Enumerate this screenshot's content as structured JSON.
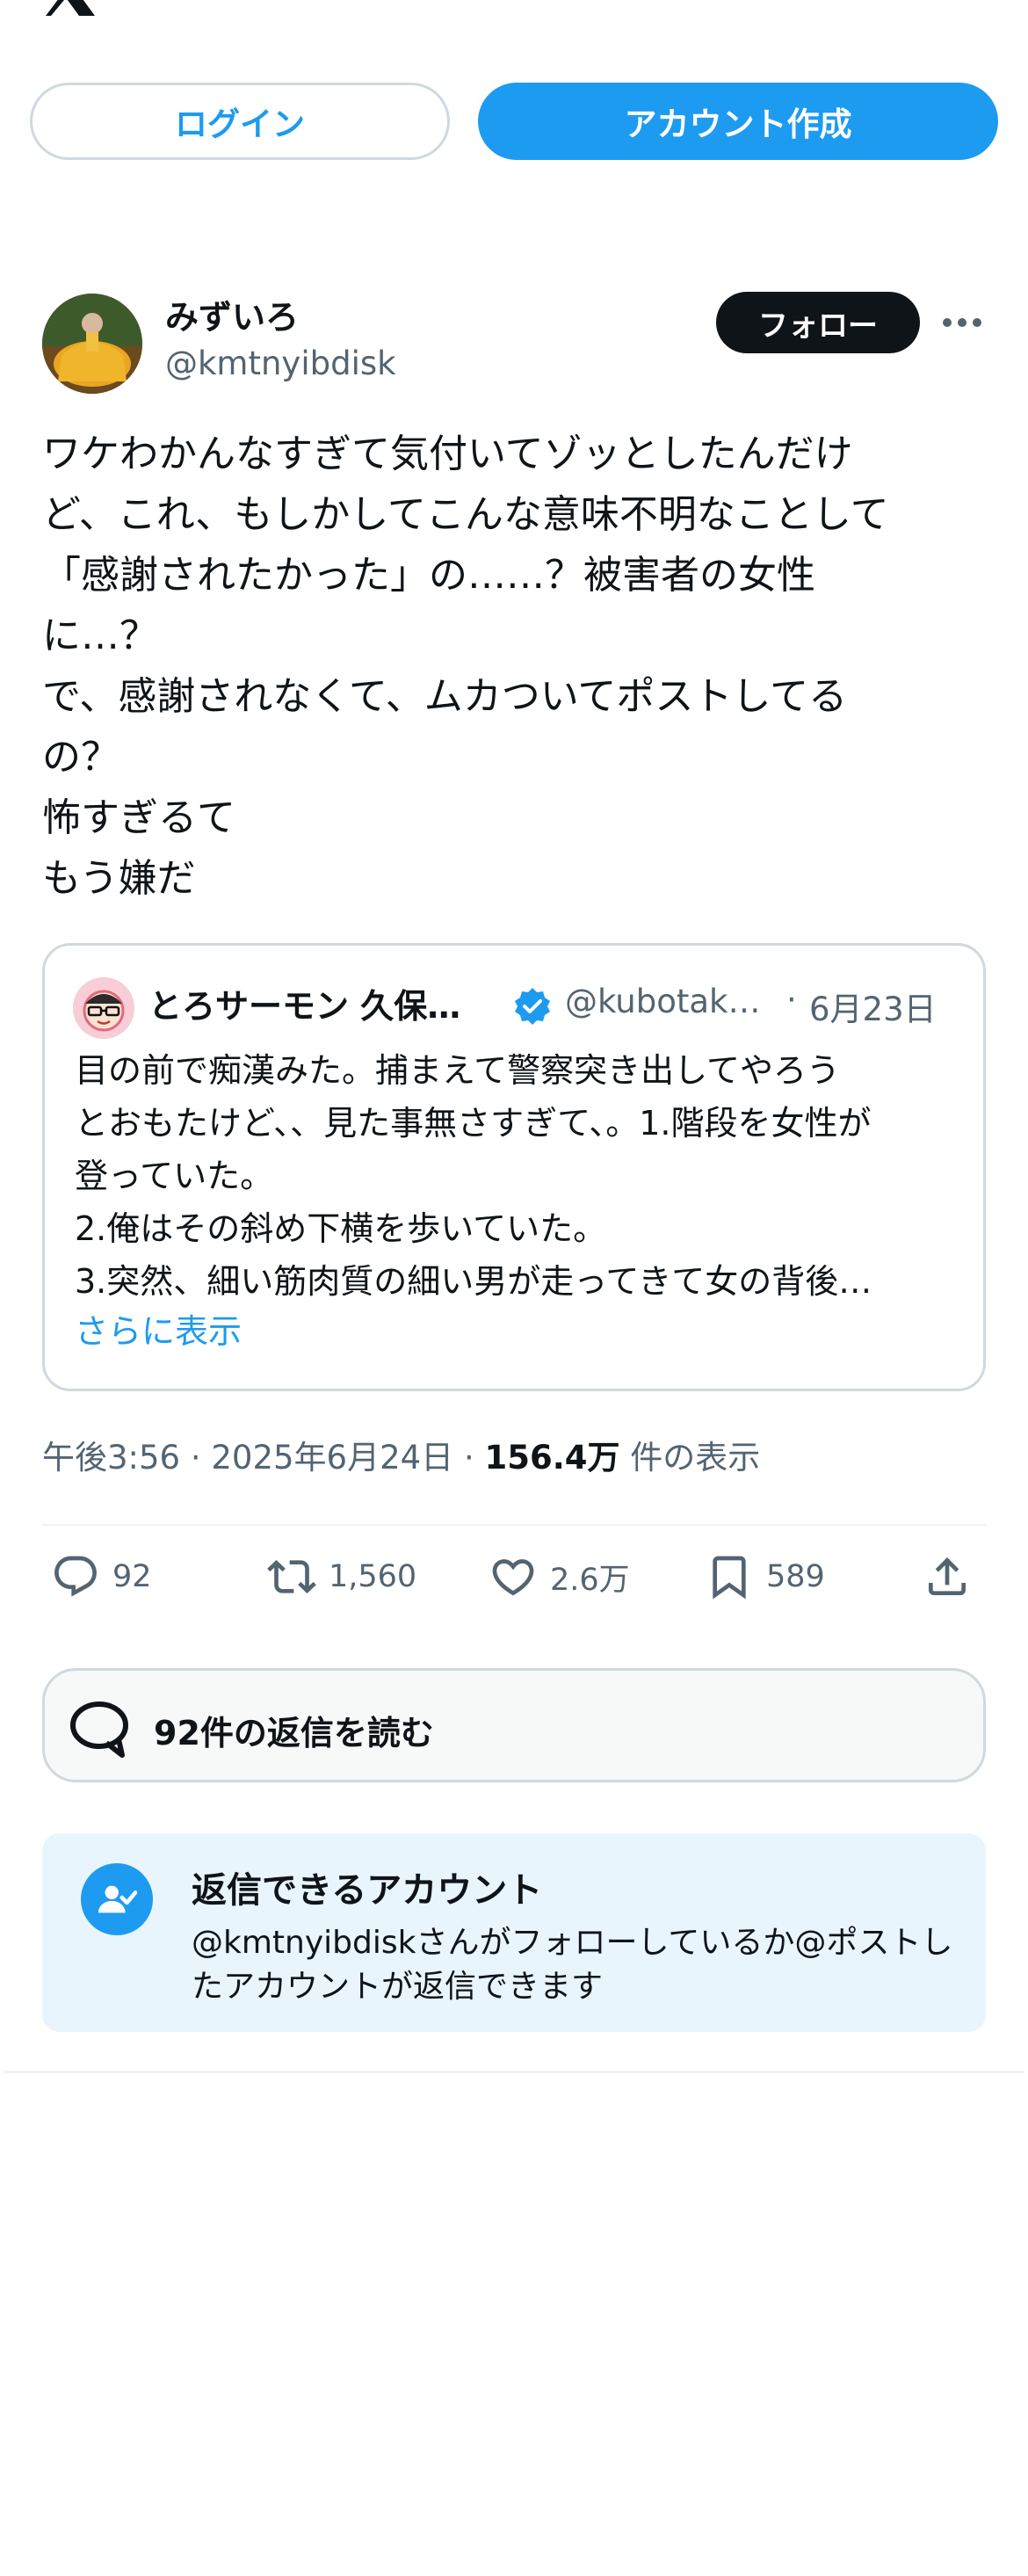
{
  "header": {
    "logo_icon": "x-logo-icon"
  },
  "auth": {
    "login_label": "ログイン",
    "signup_label": "アカウント作成"
  },
  "author": {
    "name": "みずいろ",
    "handle": "@kmtnyibdisk",
    "follow_label": "フォロー",
    "more_icon": "more-horizontal-icon"
  },
  "tweet": {
    "text": "ワケわかんなすぎて気付いてゾッとしたんだけ\nど、これ、もしかしてこんな意味不明なことして\n「感謝されたかった」の……？被害者の女性\nに…？\nで、感謝されなくて、ムカついてポストしてる\nの？\n怖すぎるて\nもう嫌だ"
  },
  "quote": {
    "name": "とろサーモン 久保…",
    "handle": "@kubotak…",
    "separator": "·",
    "date": "6月23日",
    "text": "目の前で痴漢みた。捕まえて警察突き出してやろう\nとおもたけど、、見た事無さすぎて、。1.階段を女性が\n登っていた。\n2.俺はその斜め下横を歩いていた。\n3.突然、細い筋肉質の細い男が走ってきて女の背後…",
    "show_more": "さらに表示",
    "verified_icon": "verified-badge-icon"
  },
  "meta": {
    "time": "午後3:56",
    "sep1": " · ",
    "date": "2025年6月24日",
    "sep2": " · ",
    "views": "156.4万",
    "views_label": " 件の表示"
  },
  "actions": {
    "replies": "92",
    "retweets": "1,560",
    "likes": "2.6万",
    "bookmarks": "589"
  },
  "read_replies": {
    "label": "92件の返信を読む"
  },
  "reply_policy": {
    "title": "返信できるアカウント",
    "description": "@kmtnyibdiskさんがフォローしているか@ポストしたアカウントが返信できます"
  },
  "colors": {
    "accent": "#1d9bf0",
    "text": "#0f1419",
    "secondary": "#536471",
    "border": "#cfd9de",
    "info_bg": "#e8f5fd"
  }
}
